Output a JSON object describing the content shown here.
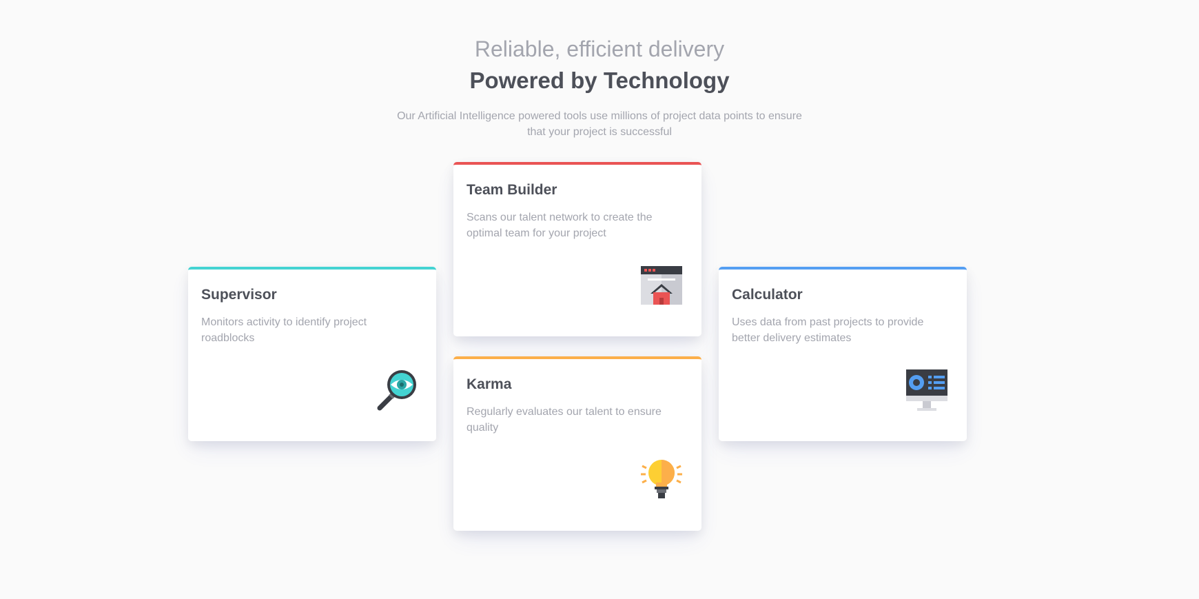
{
  "header": {
    "kicker": "Reliable, efficient delivery",
    "title": "Powered by Technology",
    "description": "Our Artificial Intelligence powered tools use millions of project data points to ensure that your project is successful"
  },
  "cards": {
    "supervisor": {
      "title": "Supervisor",
      "description": "Monitors activity to identify project roadblocks",
      "icon": "magnifier-eye-icon",
      "accent": "#44d3d2"
    },
    "team_builder": {
      "title": "Team Builder",
      "description": "Scans our talent network to create the optimal team for your project",
      "icon": "browser-house-icon",
      "accent": "#ea5454"
    },
    "karma": {
      "title": "Karma",
      "description": "Regularly evaluates our talent to ensure quality",
      "icon": "lightbulb-icon",
      "accent": "#fcaf4a"
    },
    "calculator": {
      "title": "Calculator",
      "description": "Uses data from past projects to provide better delivery estimates",
      "icon": "monitor-chart-icon",
      "accent": "#549ef2"
    }
  }
}
